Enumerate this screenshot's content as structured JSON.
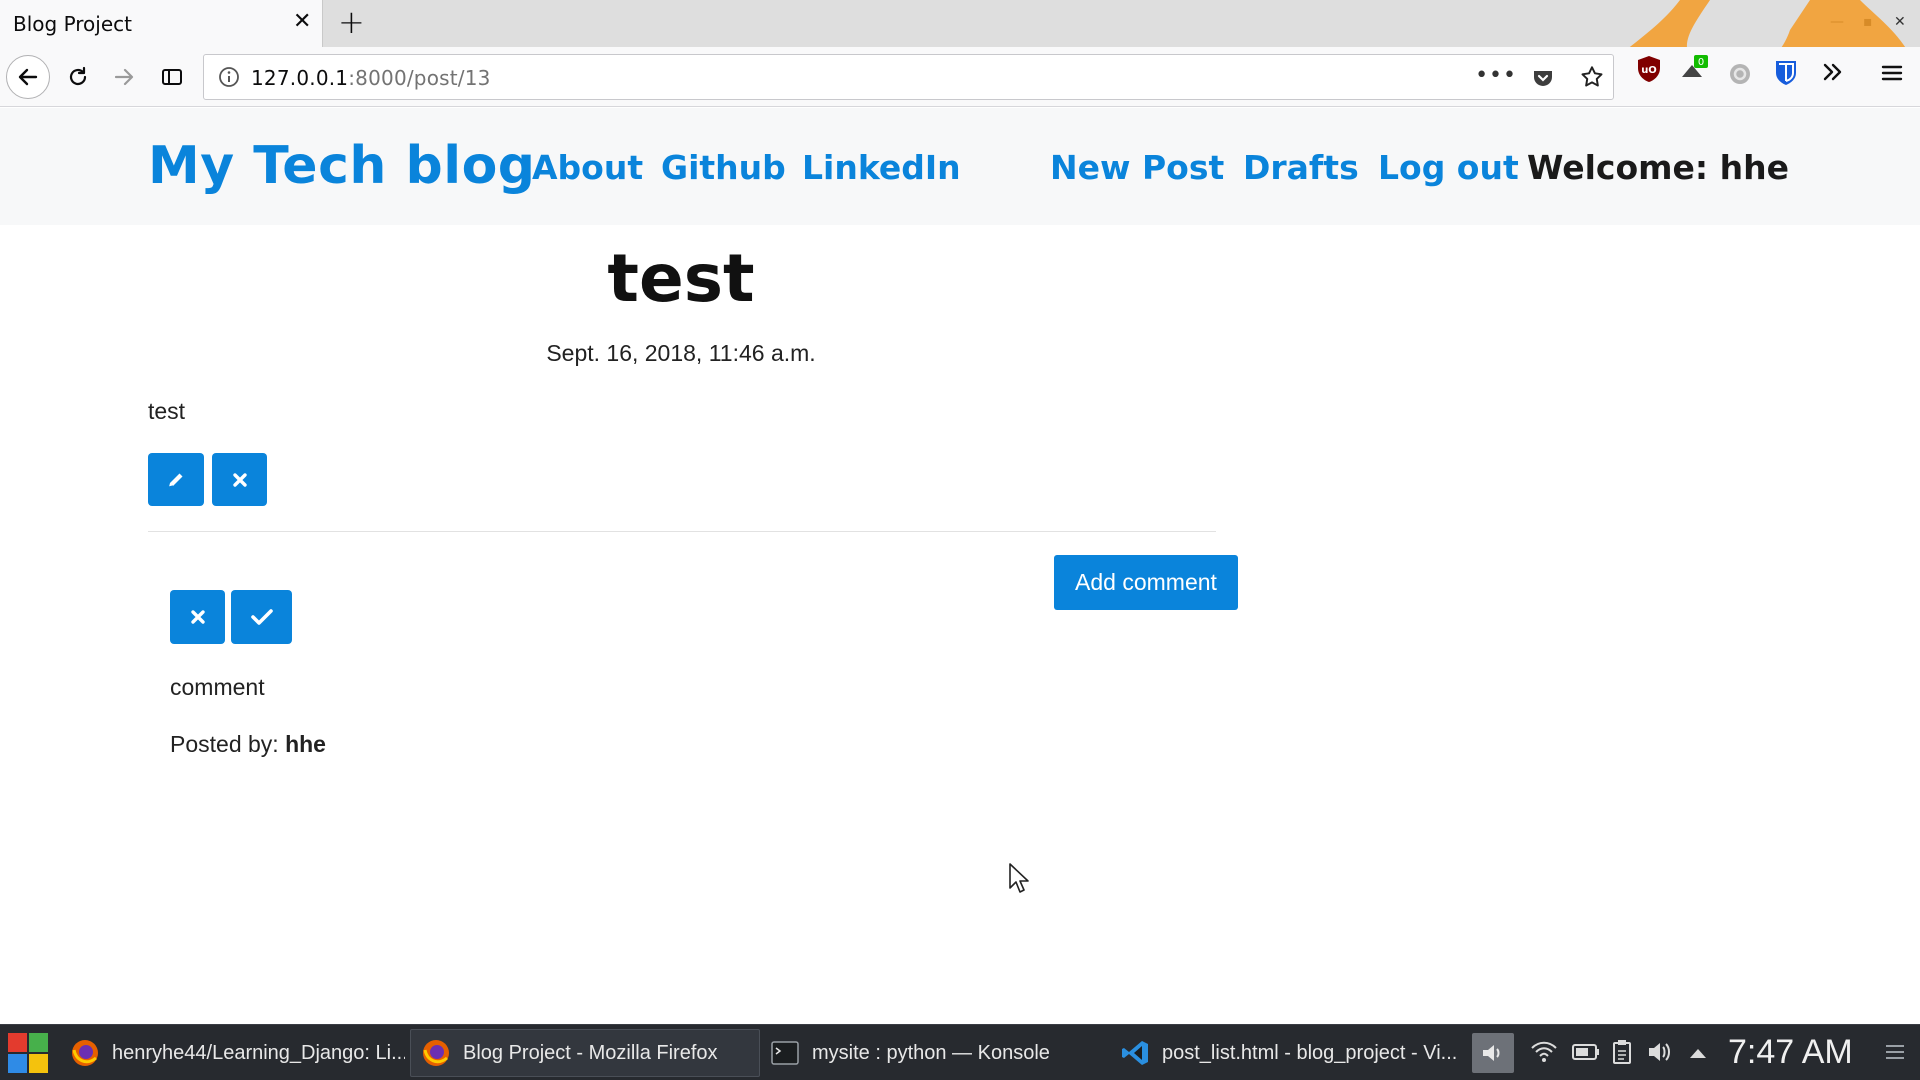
{
  "browser": {
    "tab_title": "Blog Project",
    "url_host": "127.0.0.1",
    "url_path": ":8000/post/13",
    "extension_badge": "0"
  },
  "site": {
    "brand": "My Tech blog",
    "nav": {
      "about": "About",
      "github": "Github",
      "linkedin": "LinkedIn",
      "new_post": "New Post",
      "drafts": "Drafts",
      "logout": "Log out"
    },
    "welcome": "Welcome: hhe"
  },
  "post": {
    "title": "test",
    "date": "Sept. 16, 2018, 11:46 a.m.",
    "body": "test"
  },
  "comments": {
    "add_label": "Add comment",
    "items": [
      {
        "text": "comment",
        "posted_by_label": "Posted by:",
        "author": "hhe"
      }
    ]
  },
  "taskbar": {
    "tasks": [
      "henryhe44/Learning_Django: Li...",
      "Blog Project - Mozilla Firefox",
      "mysite : python — Konsole",
      "post_list.html - blog_project - Vi..."
    ],
    "clock": "7:47 AM"
  },
  "colors": {
    "accent": "#0a84db",
    "header_bg": "#f7f8f9",
    "taskbar_bg": "#272a2f"
  }
}
